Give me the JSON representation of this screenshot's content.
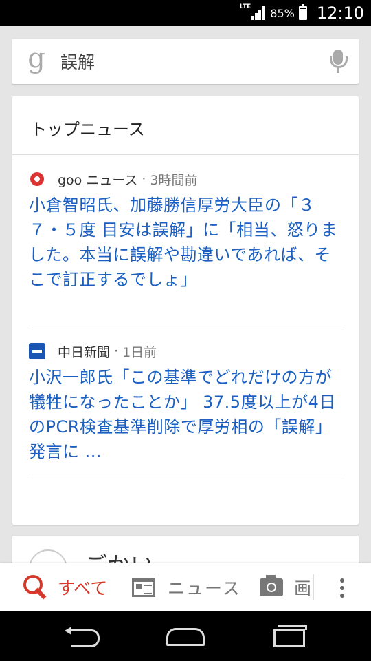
{
  "status_bar": {
    "network": "LTE",
    "battery": "85%",
    "time": "12:10"
  },
  "search": {
    "logo": "g",
    "query": "誤解"
  },
  "card": {
    "title": "トップニュース",
    "items": [
      {
        "source": "goo ニュース",
        "separator": "·",
        "time": "3時間前",
        "headline": "小倉智昭氏、加藤勝信厚労大臣の「３７・５度 目安は誤解」に「相当、怒りました。本当に誤解や勘違いであれば、そこで訂正するでしょ」"
      },
      {
        "source": "中日新聞",
        "separator": "·",
        "time": "1日前",
        "headline": "小沢一郎氏「この基準でどれだけの方が犠牲になったことか」 37.5度以上が4日のPCR検査基準削除で厚労相の「誤解」発言に ..."
      }
    ]
  },
  "next_card": {
    "title": "ごかい"
  },
  "tabs": {
    "all": "すべて",
    "news": "ニュース",
    "images": "画"
  }
}
